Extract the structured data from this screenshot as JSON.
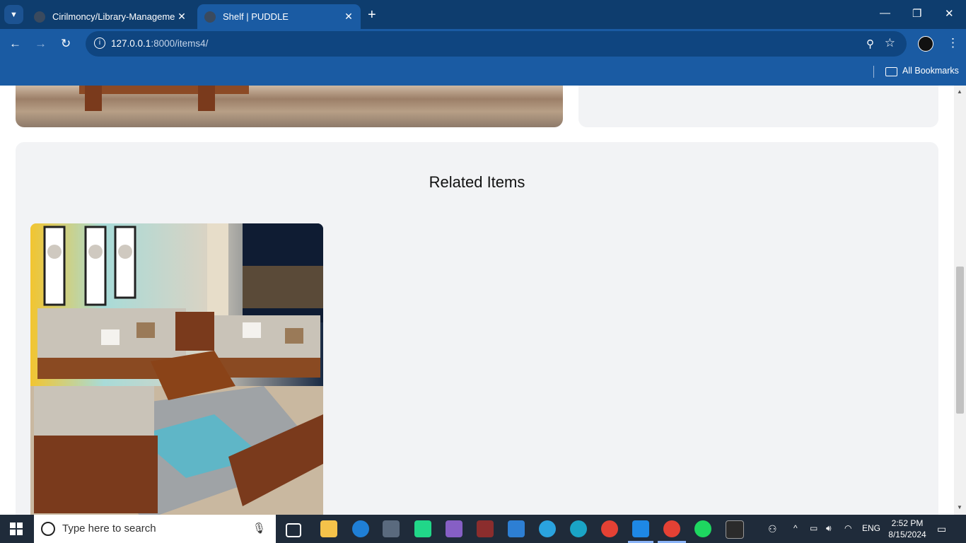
{
  "browser": {
    "tabs": [
      {
        "title": "Cirilmoncy/Library-Management"
      },
      {
        "title": "Shelf | PUDDLE"
      }
    ],
    "url_host": "127.0.0.1",
    "url_path": ":8000/items4/",
    "bookmarks_label": "All Bookmarks"
  },
  "page": {
    "related_heading": "Related Items"
  },
  "taskbar": {
    "search_placeholder": "Type here to search",
    "language": "ENG",
    "time": "2:52 PM",
    "date": "8/15/2024"
  }
}
